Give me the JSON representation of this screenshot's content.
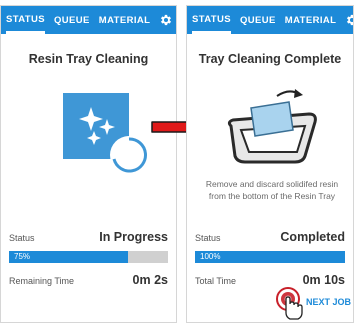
{
  "screens": [
    {
      "tabs": [
        "STATUS",
        "QUEUE",
        "MATERIAL"
      ],
      "title": "Resin Tray Cleaning",
      "status_label": "Status",
      "status_value": "In Progress",
      "progress_text": "75%",
      "progress_fraction": 0.75,
      "time_label": "Remaining Time",
      "time_value": "0m 2s"
    },
    {
      "tabs": [
        "STATUS",
        "QUEUE",
        "MATERIAL"
      ],
      "title": "Tray Cleaning Complete",
      "description_lines": [
        "Remove and discard solidifed resin",
        "from the bottom of the Resin Tray"
      ],
      "status_label": "Status",
      "status_value": "Completed",
      "progress_text": "100%",
      "progress_fraction": 1.0,
      "time_label": "Total Time",
      "time_value": "0m 10s",
      "next_job_label": "NEXT JOB"
    }
  ],
  "colors": {
    "accent": "#1d8ad8",
    "track": "#d0d0d0",
    "arrow": "#e01a1a",
    "tap_indicator": "#c8202a"
  },
  "icons": [
    "gear-icon",
    "sparkle-icon",
    "resin-tray-icon",
    "arrow-right-icon",
    "hand-pointer-icon"
  ]
}
